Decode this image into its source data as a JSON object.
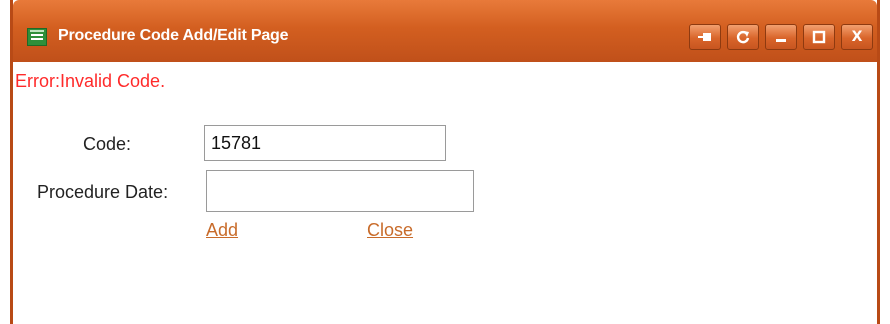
{
  "window": {
    "title": "Procedure Code Add/Edit Page",
    "buttons": {
      "pin_icon": "pin-icon",
      "refresh_icon": "refresh-icon",
      "minimize_icon": "minimize-icon",
      "maximize_icon": "maximize-icon",
      "close_label": "X"
    }
  },
  "form": {
    "error_message": "Error:Invalid Code.",
    "code_label": "Code:",
    "code_value": "15781",
    "procedure_date_label": "Procedure Date:",
    "procedure_date_value": "",
    "add_link": "Add",
    "close_link": "Close"
  },
  "colors": {
    "titlebar": "#d35f20",
    "error_text": "#ff2a2a",
    "link_text": "#c86b2a"
  }
}
